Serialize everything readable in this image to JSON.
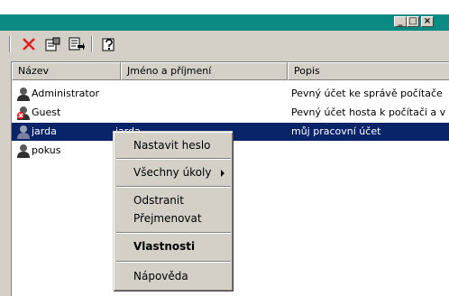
{
  "window": {
    "controls": {
      "minimize": "_",
      "maximize": "□",
      "close": "×"
    }
  },
  "toolbar": {
    "icons": [
      "delete-icon",
      "properties-icon",
      "export-list-icon",
      "help-icon"
    ]
  },
  "columns": [
    "Název",
    "Jméno a příjmení",
    "Popis"
  ],
  "users": [
    {
      "name": "Administrator",
      "full_name": "",
      "description": "Pevný účet ke správě počítače",
      "selected": false,
      "disabled": false
    },
    {
      "name": "Guest",
      "full_name": "",
      "description": "Pevný účet hosta k počítači a v",
      "selected": false,
      "disabled": true
    },
    {
      "name": "jarda",
      "full_name": "jarda",
      "description": "můj pracovní účet",
      "selected": true,
      "disabled": false
    },
    {
      "name": "pokus",
      "full_name": "",
      "description": "",
      "selected": false,
      "disabled": false
    }
  ],
  "context_menu": {
    "set_password": "Nastavit heslo",
    "all_tasks": "Všechny úkoly",
    "delete": "Odstranit",
    "rename": "Přejmenovat",
    "properties": "Vlastnosti",
    "help": "Nápověda"
  },
  "colors": {
    "title_bar": "#0a8a82",
    "selection": "#0a246a",
    "delete_icon": "#e02020"
  }
}
